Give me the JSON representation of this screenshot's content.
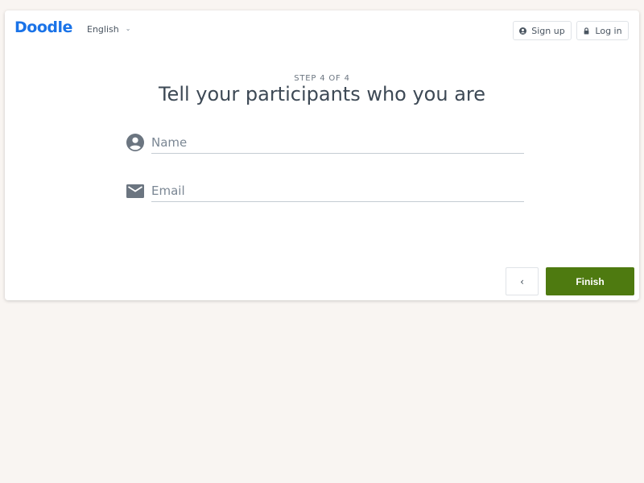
{
  "header": {
    "logo": "Doodle",
    "language": "English",
    "signup_label": "Sign up",
    "login_label": "Log in"
  },
  "step": {
    "label": "STEP 4 OF 4",
    "title": "Tell your participants who you are"
  },
  "form": {
    "name_placeholder": "Name",
    "name_value": "",
    "email_placeholder": "Email",
    "email_value": ""
  },
  "footer": {
    "back_label": "‹",
    "finish_label": "Finish"
  },
  "colors": {
    "brand": "#1a73e8",
    "primary_button": "#4e7a10",
    "background": "#f9f5f2"
  },
  "icons": {
    "signup": "user-circle-icon",
    "login": "lock-icon",
    "name_field": "person-icon",
    "email_field": "envelope-icon",
    "back": "chevron-left-icon",
    "language": "chevron-down-icon"
  }
}
